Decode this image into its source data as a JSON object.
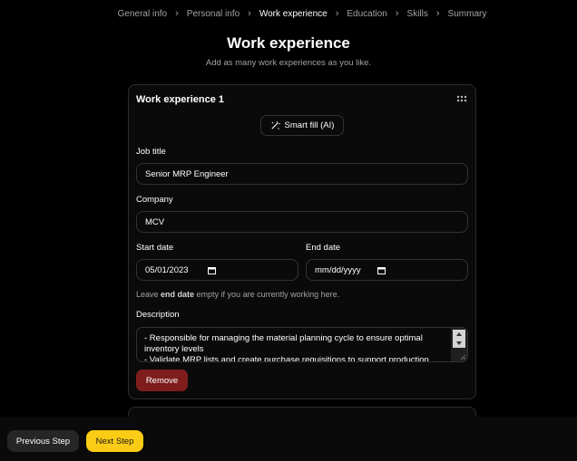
{
  "breadcrumb": {
    "items": [
      "General info",
      "Personal info",
      "Work experience",
      "Education",
      "Skills",
      "Summary"
    ],
    "active_index": 2
  },
  "header": {
    "title": "Work experience",
    "subtitle": "Add as many work experiences as you like."
  },
  "card": {
    "title": "Work experience 1",
    "smart_fill_label": "Smart fill (AI)",
    "job_title_label": "Job title",
    "job_title_value": "Senior MRP Engineer",
    "company_label": "Company",
    "company_value": "MCV",
    "start_date_label": "Start date",
    "start_date_value": "05/01/2023",
    "end_date_label": "End date",
    "end_date_value": "mm/dd/yyyy",
    "hint_prefix": "Leave ",
    "hint_bold": "end date",
    "hint_suffix": " empty if you are currently working here.",
    "description_label": "Description",
    "description_value": "- Responsible for managing the material planning cycle to ensure optimal inventory levels\n- Validate MRP lists and create purchase requisitions to support production",
    "remove_label": "Remove"
  },
  "footer": {
    "previous_label": "Previous Step",
    "next_label": "Next Step"
  },
  "colors": {
    "background": "#000000",
    "remove": "#7f1d1d",
    "next": "#facc15"
  }
}
